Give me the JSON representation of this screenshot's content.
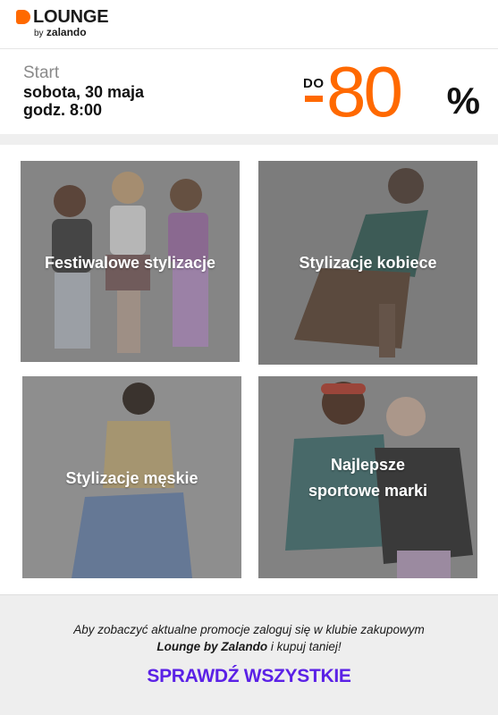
{
  "brand": {
    "name": "LOUNGE",
    "by": "by",
    "sub": "zalando",
    "accent_color": "#ff6900"
  },
  "promo": {
    "start_label": "Start",
    "date": "sobota, 30 maja",
    "time": "godz. 8:00",
    "discount_prefix": "DO",
    "discount_value": "80",
    "discount_sign": "-",
    "discount_unit": "%"
  },
  "tiles": [
    {
      "label": "Festiwalowe stylizacje"
    },
    {
      "label": "Stylizacje kobiece"
    },
    {
      "label": "Stylizacje męskie"
    },
    {
      "label_line1": "Najlepsze",
      "label_line2": "sportowe marki"
    }
  ],
  "footer": {
    "line1": "Aby zobaczyć aktualne promocje zaloguj się w klubie zakupowym",
    "brand_bold": "Lounge by Zalando",
    "line2_rest": " i kupuj taniej!",
    "cta_label": "SPRAWDŹ WSZYSTKIE",
    "cta_color": "#5b21e6"
  }
}
